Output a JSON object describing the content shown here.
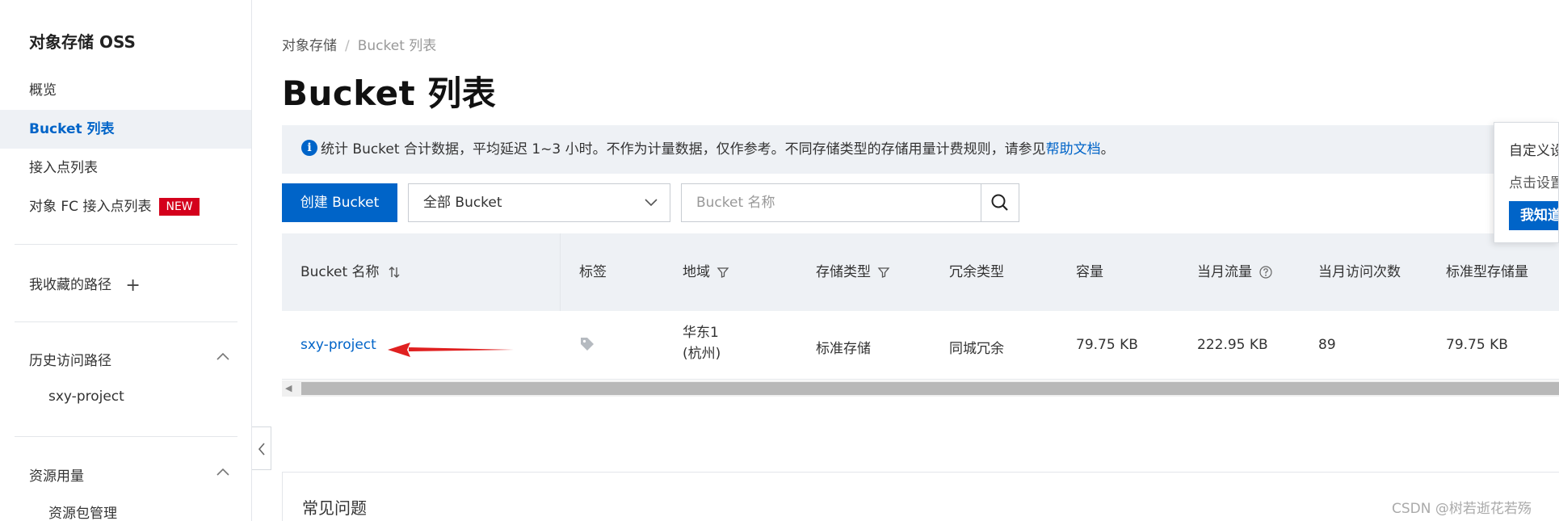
{
  "sidebar": {
    "title": "对象存储 OSS",
    "items": [
      {
        "label": "概览"
      },
      {
        "label": "Bucket 列表"
      },
      {
        "label": "接入点列表"
      },
      {
        "label": "对象 FC 接入点列表",
        "badge": "NEW"
      }
    ],
    "favorites": {
      "label": "我收藏的路径",
      "action": "+"
    },
    "history": {
      "label": "历史访问路径",
      "items": [
        "sxy-project"
      ]
    },
    "resources": {
      "label": "资源用量",
      "items": [
        "资源包管理"
      ]
    }
  },
  "breadcrumb": {
    "root": "对象存储",
    "separator": "/",
    "current": "Bucket 列表"
  },
  "page": {
    "title": "Bucket 列表"
  },
  "notice": {
    "text": "统计 Bucket 合计数据，平均延迟 1~3 小时。不作为计量数据，仅作参考。不同存储类型的存储用量计费规则，请参见",
    "link": "帮助文档",
    "suffix": "。"
  },
  "toolbar": {
    "create_label": "创建 Bucket",
    "filter_selected": "全部 Bucket",
    "search_placeholder": "Bucket 名称"
  },
  "table": {
    "headers": [
      "Bucket 名称",
      "标签",
      "地域",
      "存储类型",
      "冗余类型",
      "容量",
      "当月流量",
      "当月访问次数",
      "标准型存储量"
    ],
    "rows": [
      {
        "name": "sxy-project",
        "region_line1": "华东1",
        "region_line2": "(杭州)",
        "storage_type": "标准存储",
        "redundancy": "同城冗余",
        "capacity": "79.75 KB",
        "traffic": "222.95 KB",
        "visits": "89",
        "standard_storage": "79.75 KB"
      }
    ]
  },
  "faq": {
    "title": "常见问题"
  },
  "popup": {
    "title": "自定义设",
    "text": "点击设置",
    "button": "我知道"
  },
  "watermark": "CSDN @树若逝花若殇",
  "colors": {
    "accent": "#0064c8",
    "badge": "#d4001c",
    "annotation_arrow": "#e02020"
  }
}
